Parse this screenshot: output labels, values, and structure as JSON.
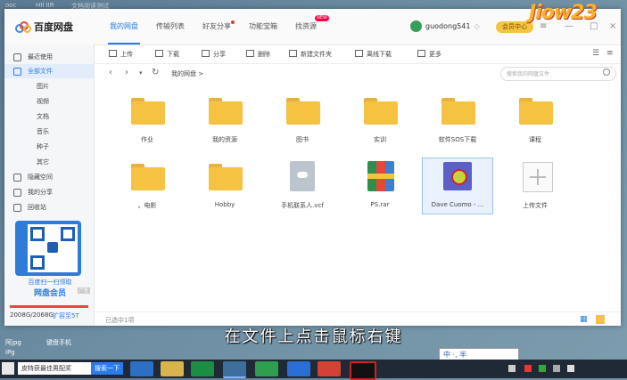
{
  "desktop_top": [
    "ooc",
    "HII IIR",
    "文档阅读测试"
  ],
  "app": {
    "title": "百度网盘",
    "nav": [
      {
        "label": "我的网盘",
        "active": true
      },
      {
        "label": "传输列表"
      },
      {
        "label": "好友分享",
        "dot": true
      },
      {
        "label": "功能宝箱"
      },
      {
        "label": "找资源",
        "badge": "NEW"
      }
    ],
    "username": "guodong541",
    "vip_button": "会员中心",
    "watermark": "Jiow23"
  },
  "sidebar": {
    "items": [
      {
        "label": "最近使用"
      },
      {
        "label": "全部文件",
        "active": true
      },
      {
        "label": "图片"
      },
      {
        "label": "视频"
      },
      {
        "label": "文档"
      },
      {
        "label": "音乐"
      },
      {
        "label": "种子"
      },
      {
        "label": "其它"
      },
      {
        "label": "隐藏空间"
      },
      {
        "label": "我的分享"
      },
      {
        "label": "回收站"
      }
    ],
    "qr_caption": "百度扫一扫领取",
    "qr_title": "网盘会员",
    "qr_tag": "广告",
    "quota": "2008G/2068G",
    "quota_link": "扩容至5T"
  },
  "toolbar": {
    "upload": "上传",
    "download": "下载",
    "share": "分享",
    "delete": "删除",
    "new_folder": "新建文件夹",
    "offline_download": "离线下载",
    "more": "更多"
  },
  "pathbar": {
    "crumb": "我的网盘 >",
    "search_placeholder": "搜索我的网盘文件"
  },
  "files": [
    {
      "name": "作业",
      "type": "folder"
    },
    {
      "name": "我的资源",
      "type": "folder"
    },
    {
      "name": "图书",
      "type": "folder"
    },
    {
      "name": "实训",
      "type": "folder"
    },
    {
      "name": "软件SOS下载",
      "type": "folder"
    },
    {
      "name": "课程",
      "type": "folder"
    },
    {
      "name": "。电影",
      "type": "folder"
    },
    {
      "name": "Hobby",
      "type": "folder"
    },
    {
      "name": "手机联系人.vcf",
      "type": "vcf"
    },
    {
      "name": "PS.rar",
      "type": "rar"
    },
    {
      "name": "Dave Cuomo - ...",
      "type": "image",
      "selected": true
    },
    {
      "name": "上传文件",
      "type": "upload"
    }
  ],
  "status": {
    "text": "已选中1项"
  },
  "subtitle": "在文件上点击鼠标右键",
  "ime": "中 ·, 半",
  "desktop_icons": [
    "阿jpg",
    "键盘手机",
    "iPg"
  ],
  "taskbar": {
    "search_text": "皮特获最佳男配奖",
    "search_button": "搜索一下"
  },
  "colors": {
    "accent": "#2b7ce9",
    "folder": "#f5c242",
    "quota_bar": "#e44444"
  }
}
